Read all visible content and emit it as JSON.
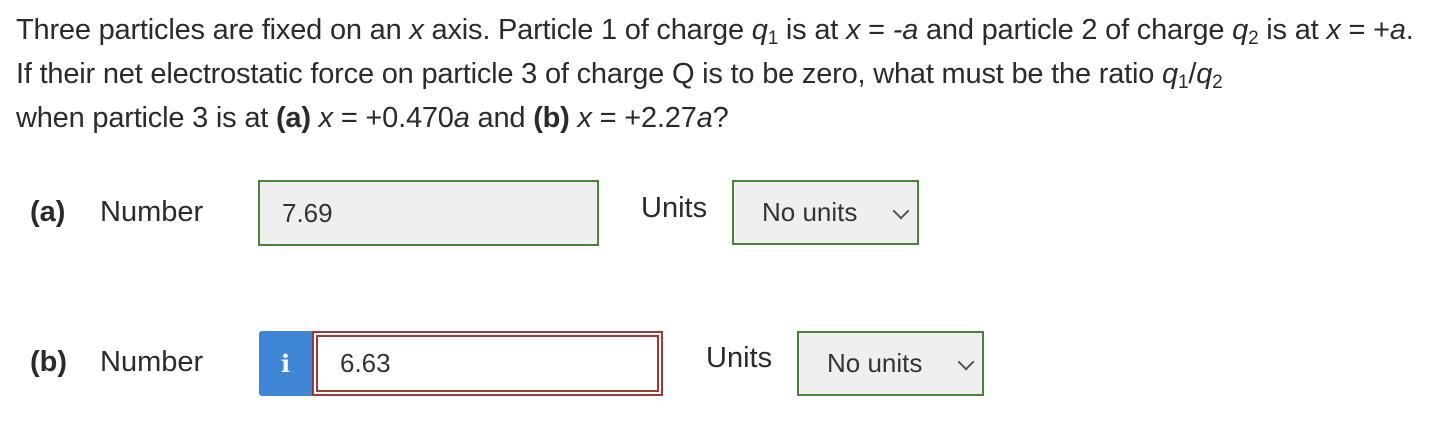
{
  "question": {
    "s1": "Three particles are fixed on an ",
    "x1": "x",
    "s2": " axis. Particle 1 of charge ",
    "q1a": "q",
    "q1a_sub": "1",
    "s3": " is at ",
    "x2": "x",
    "s4": " = ",
    "neg_a": "-a",
    "s5": " and particle 2 of charge ",
    "q2a": "q",
    "q2a_sub": "2",
    "s6": " is at ",
    "x3": "x",
    "s7": " = +",
    "a1": "a",
    "s8": ". If their net electrostatic force on particle 3 of charge Q is to be zero, what must be the ratio ",
    "q1b": "q",
    "q1b_sub": "1",
    "slash": "/",
    "q2b": "q",
    "q2b_sub": "2",
    "s9": " when particle 3 is at ",
    "part_a_tag": "(a)",
    "s10": " ",
    "x4": "x",
    "s11": " = +0.470",
    "a2": "a",
    "s12": " and ",
    "part_b_tag": "(b)",
    "s13": " ",
    "x5": "x",
    "s14": " = +2.27",
    "a3": "a",
    "s15": "?"
  },
  "part_a": {
    "label": "(a)",
    "number_label": "Number",
    "value": "7.69",
    "units_label": "Units",
    "units_value": "No units"
  },
  "part_b": {
    "label": "(b)",
    "number_label": "Number",
    "info_icon": "i",
    "value": "6.63",
    "units_label": "Units",
    "units_value": "No units"
  },
  "colors": {
    "correct_border": "#4f7f3a",
    "incorrect_border": "#9b3a3a",
    "info_blue": "#3f86d6"
  }
}
